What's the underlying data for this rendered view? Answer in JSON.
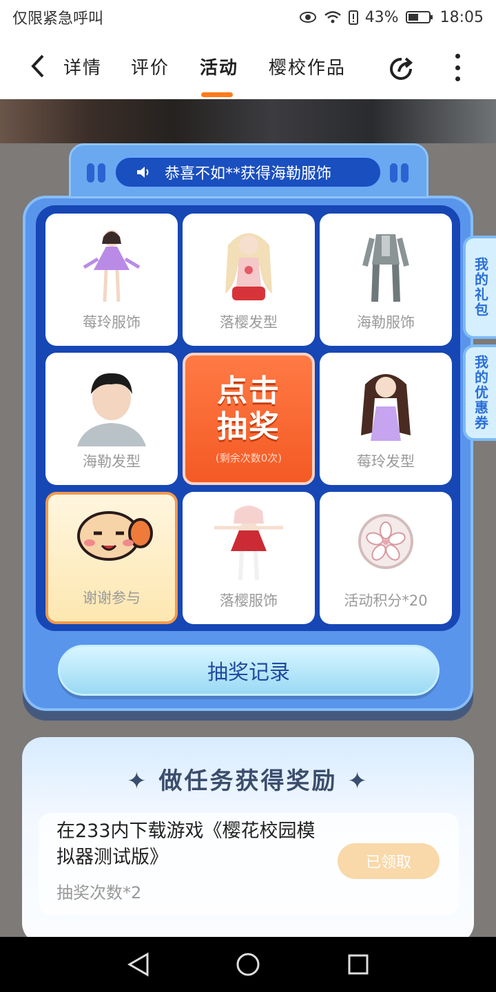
{
  "status_bar": {
    "left_text": "仅限紧急呼叫",
    "battery": "43%",
    "time": "18:05",
    "icons": [
      "eye-icon",
      "wifi-icon",
      "battery-alert-icon",
      "battery-icon"
    ]
  },
  "nav": {
    "tabs": [
      {
        "label": "详情",
        "active": false
      },
      {
        "label": "评价",
        "active": false
      },
      {
        "label": "活动",
        "active": true
      },
      {
        "label": "樱校作品",
        "active": false
      }
    ],
    "accent_color": "#ff7a1a"
  },
  "lottery": {
    "ticker": "恭喜不如**获得海勒服饰",
    "cells": [
      {
        "label": "莓玲服饰",
        "icon": "purple-dress-figure"
      },
      {
        "label": "落樱发型",
        "icon": "blonde-hair-figure"
      },
      {
        "label": "海勒服饰",
        "icon": "grey-suit-figure"
      },
      {
        "label": "海勒发型",
        "icon": "dark-hair-boy-figure"
      },
      {
        "label": "莓玲发型",
        "icon": "brown-hair-girl-figure"
      },
      {
        "label": "谢谢参与",
        "icon": "thanks-face-icon"
      },
      {
        "label": "落樱服饰",
        "icon": "red-dress-figure"
      },
      {
        "label": "活动积分*20",
        "icon": "sakura-coin-icon"
      }
    ],
    "draw_button": {
      "line1": "点击",
      "line2": "抽奖",
      "remaining": "(剩余次数0次)"
    },
    "record_button": "抽奖记录",
    "side_tabs": [
      "我的礼包",
      "我的优惠券"
    ]
  },
  "tasks": {
    "title": "做任务获得奖励",
    "items": [
      {
        "text": "在233内下载游戏《樱花校园模拟器测试版》",
        "reward": "抽奖次数*2",
        "button": "已领取"
      }
    ]
  }
}
